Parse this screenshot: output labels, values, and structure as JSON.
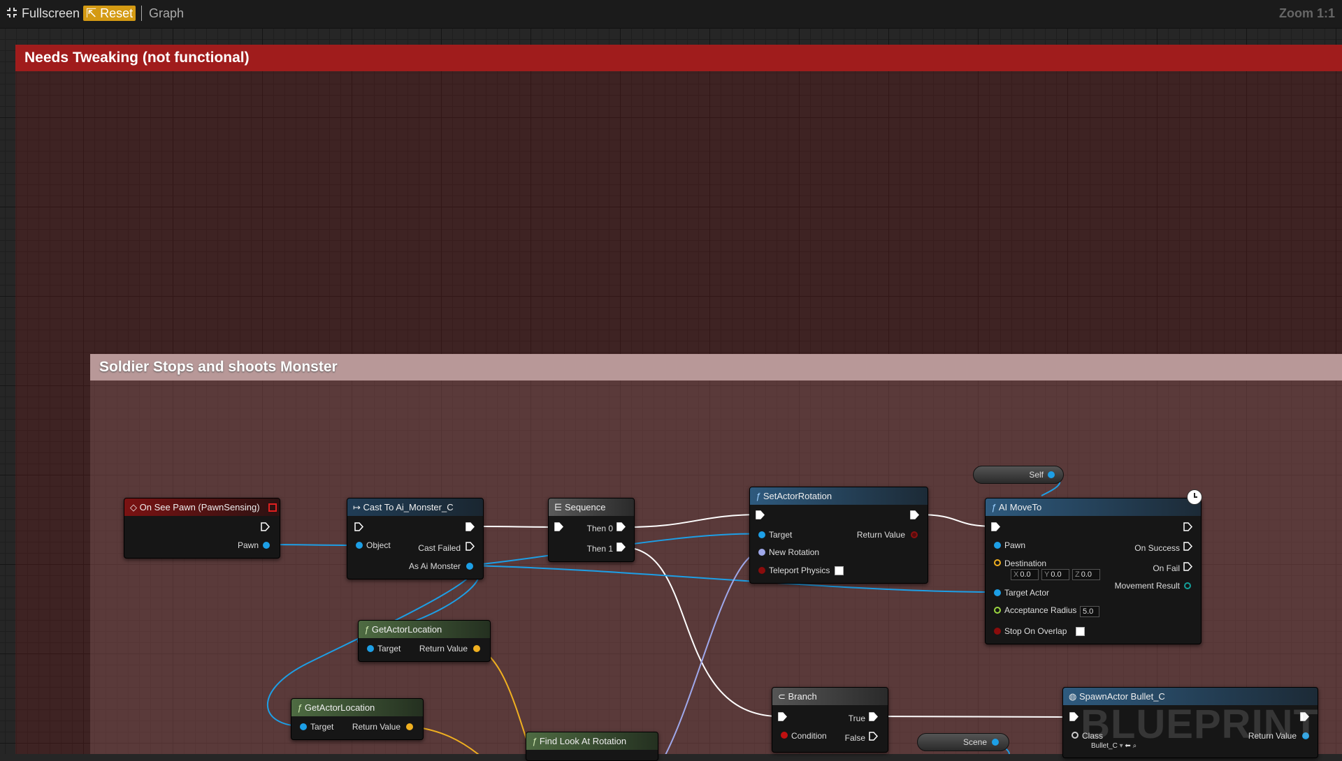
{
  "toolbar": {
    "fullscreen_label": "Fullscreen",
    "reset_label": "Reset",
    "graph_label": "Graph",
    "zoom_label": "Zoom 1:1"
  },
  "comments": {
    "top": "Needs Tweaking (not functional)",
    "bottom": "Soldier Stops and shoots Monster"
  },
  "nodes": {
    "on_see_pawn": {
      "title": "On See Pawn (PawnSensing)",
      "pawn": "Pawn"
    },
    "cast": {
      "title": "Cast To Ai_Monster_C",
      "object": "Object",
      "cast_failed": "Cast Failed",
      "as_ai_monster": "As Ai Monster"
    },
    "sequence": {
      "title": "Sequence",
      "then0": "Then 0",
      "then1": "Then 1"
    },
    "set_actor_rotation": {
      "title": "SetActorRotation",
      "target": "Target",
      "return_value": "Return Value",
      "new_rotation": "New Rotation",
      "teleport_physics": "Teleport Physics"
    },
    "self": {
      "label": "Self"
    },
    "ai_move_to": {
      "title": "AI MoveTo",
      "pawn": "Pawn",
      "on_success": "On Success",
      "destination": "Destination",
      "on_fail": "On Fail",
      "x": "0.0",
      "y": "0.0",
      "z": "0.0",
      "target_actor": "Target Actor",
      "movement_result": "Movement Result",
      "acceptance_radius": "Acceptance Radius",
      "radius_value": "5.0",
      "stop_on_overlap": "Stop On Overlap"
    },
    "get_actor_location_1": {
      "title": "GetActorLocation",
      "target": "Target",
      "return_value": "Return Value"
    },
    "get_actor_location_2": {
      "title": "GetActorLocation",
      "target": "Target",
      "return_value": "Return Value"
    },
    "find_look_at": {
      "title": "Find Look At Rotation"
    },
    "branch": {
      "title": "Branch",
      "true": "True",
      "false": "False",
      "condition": "Condition"
    },
    "scene": {
      "label": "Scene"
    },
    "spawn_actor": {
      "title": "SpawnActor Bullet_C",
      "class": "Class",
      "class_value": "Bullet_C",
      "return_value": "Return Value"
    }
  },
  "watermark": "BLUEPRINT"
}
